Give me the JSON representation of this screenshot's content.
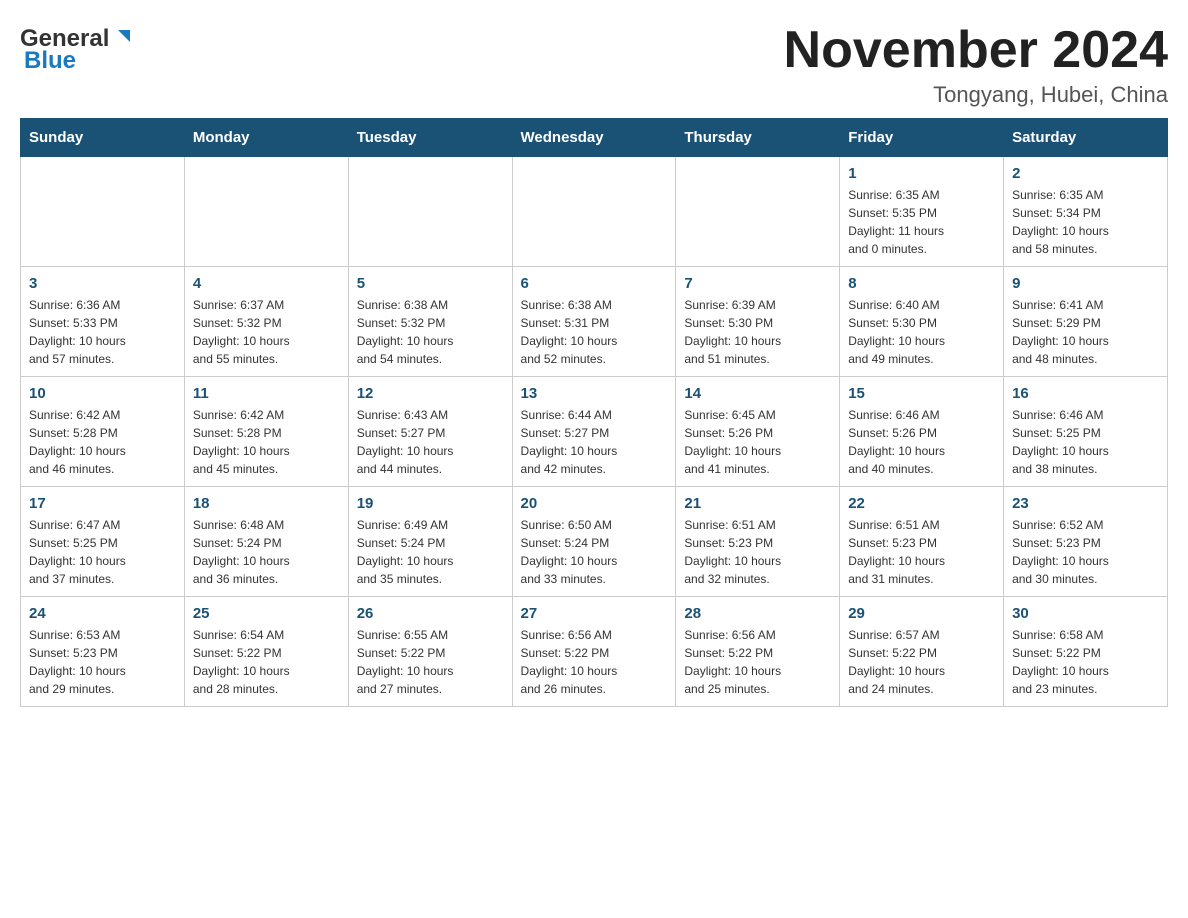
{
  "header": {
    "logo_general": "General",
    "logo_blue": "Blue",
    "month_title": "November 2024",
    "location": "Tongyang, Hubei, China"
  },
  "weekdays": [
    "Sunday",
    "Monday",
    "Tuesday",
    "Wednesday",
    "Thursday",
    "Friday",
    "Saturday"
  ],
  "weeks": [
    [
      {
        "day": "",
        "info": ""
      },
      {
        "day": "",
        "info": ""
      },
      {
        "day": "",
        "info": ""
      },
      {
        "day": "",
        "info": ""
      },
      {
        "day": "",
        "info": ""
      },
      {
        "day": "1",
        "info": "Sunrise: 6:35 AM\nSunset: 5:35 PM\nDaylight: 11 hours\nand 0 minutes."
      },
      {
        "day": "2",
        "info": "Sunrise: 6:35 AM\nSunset: 5:34 PM\nDaylight: 10 hours\nand 58 minutes."
      }
    ],
    [
      {
        "day": "3",
        "info": "Sunrise: 6:36 AM\nSunset: 5:33 PM\nDaylight: 10 hours\nand 57 minutes."
      },
      {
        "day": "4",
        "info": "Sunrise: 6:37 AM\nSunset: 5:32 PM\nDaylight: 10 hours\nand 55 minutes."
      },
      {
        "day": "5",
        "info": "Sunrise: 6:38 AM\nSunset: 5:32 PM\nDaylight: 10 hours\nand 54 minutes."
      },
      {
        "day": "6",
        "info": "Sunrise: 6:38 AM\nSunset: 5:31 PM\nDaylight: 10 hours\nand 52 minutes."
      },
      {
        "day": "7",
        "info": "Sunrise: 6:39 AM\nSunset: 5:30 PM\nDaylight: 10 hours\nand 51 minutes."
      },
      {
        "day": "8",
        "info": "Sunrise: 6:40 AM\nSunset: 5:30 PM\nDaylight: 10 hours\nand 49 minutes."
      },
      {
        "day": "9",
        "info": "Sunrise: 6:41 AM\nSunset: 5:29 PM\nDaylight: 10 hours\nand 48 minutes."
      }
    ],
    [
      {
        "day": "10",
        "info": "Sunrise: 6:42 AM\nSunset: 5:28 PM\nDaylight: 10 hours\nand 46 minutes."
      },
      {
        "day": "11",
        "info": "Sunrise: 6:42 AM\nSunset: 5:28 PM\nDaylight: 10 hours\nand 45 minutes."
      },
      {
        "day": "12",
        "info": "Sunrise: 6:43 AM\nSunset: 5:27 PM\nDaylight: 10 hours\nand 44 minutes."
      },
      {
        "day": "13",
        "info": "Sunrise: 6:44 AM\nSunset: 5:27 PM\nDaylight: 10 hours\nand 42 minutes."
      },
      {
        "day": "14",
        "info": "Sunrise: 6:45 AM\nSunset: 5:26 PM\nDaylight: 10 hours\nand 41 minutes."
      },
      {
        "day": "15",
        "info": "Sunrise: 6:46 AM\nSunset: 5:26 PM\nDaylight: 10 hours\nand 40 minutes."
      },
      {
        "day": "16",
        "info": "Sunrise: 6:46 AM\nSunset: 5:25 PM\nDaylight: 10 hours\nand 38 minutes."
      }
    ],
    [
      {
        "day": "17",
        "info": "Sunrise: 6:47 AM\nSunset: 5:25 PM\nDaylight: 10 hours\nand 37 minutes."
      },
      {
        "day": "18",
        "info": "Sunrise: 6:48 AM\nSunset: 5:24 PM\nDaylight: 10 hours\nand 36 minutes."
      },
      {
        "day": "19",
        "info": "Sunrise: 6:49 AM\nSunset: 5:24 PM\nDaylight: 10 hours\nand 35 minutes."
      },
      {
        "day": "20",
        "info": "Sunrise: 6:50 AM\nSunset: 5:24 PM\nDaylight: 10 hours\nand 33 minutes."
      },
      {
        "day": "21",
        "info": "Sunrise: 6:51 AM\nSunset: 5:23 PM\nDaylight: 10 hours\nand 32 minutes."
      },
      {
        "day": "22",
        "info": "Sunrise: 6:51 AM\nSunset: 5:23 PM\nDaylight: 10 hours\nand 31 minutes."
      },
      {
        "day": "23",
        "info": "Sunrise: 6:52 AM\nSunset: 5:23 PM\nDaylight: 10 hours\nand 30 minutes."
      }
    ],
    [
      {
        "day": "24",
        "info": "Sunrise: 6:53 AM\nSunset: 5:23 PM\nDaylight: 10 hours\nand 29 minutes."
      },
      {
        "day": "25",
        "info": "Sunrise: 6:54 AM\nSunset: 5:22 PM\nDaylight: 10 hours\nand 28 minutes."
      },
      {
        "day": "26",
        "info": "Sunrise: 6:55 AM\nSunset: 5:22 PM\nDaylight: 10 hours\nand 27 minutes."
      },
      {
        "day": "27",
        "info": "Sunrise: 6:56 AM\nSunset: 5:22 PM\nDaylight: 10 hours\nand 26 minutes."
      },
      {
        "day": "28",
        "info": "Sunrise: 6:56 AM\nSunset: 5:22 PM\nDaylight: 10 hours\nand 25 minutes."
      },
      {
        "day": "29",
        "info": "Sunrise: 6:57 AM\nSunset: 5:22 PM\nDaylight: 10 hours\nand 24 minutes."
      },
      {
        "day": "30",
        "info": "Sunrise: 6:58 AM\nSunset: 5:22 PM\nDaylight: 10 hours\nand 23 minutes."
      }
    ]
  ]
}
